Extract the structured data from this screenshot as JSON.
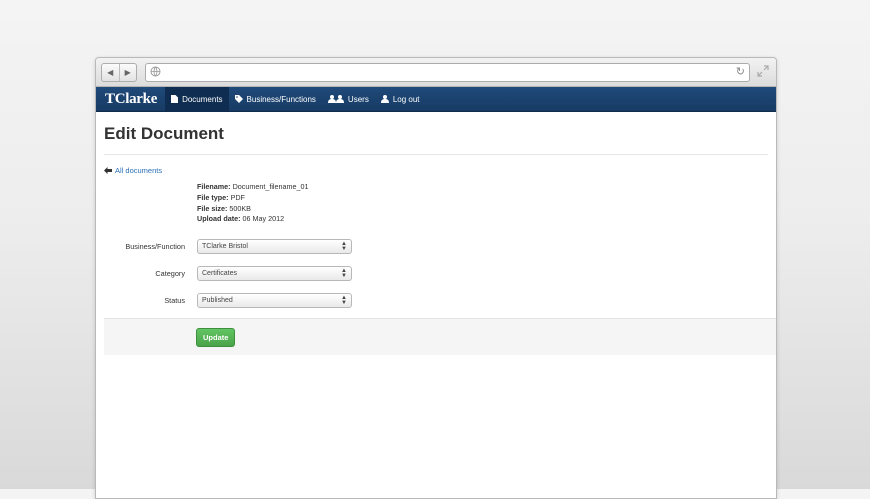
{
  "browser": {
    "url": ""
  },
  "nav": {
    "brand": "TClarke",
    "items": [
      {
        "label": "Documents",
        "icon": "file-icon"
      },
      {
        "label": "Business/Functions",
        "icon": "tag-icon"
      },
      {
        "label": "Users",
        "icon": "users-icon"
      },
      {
        "label": "Log out",
        "icon": "user-icon"
      }
    ]
  },
  "page": {
    "title": "Edit Document",
    "back_link": "All documents"
  },
  "file_info": {
    "filename_label": "Filename:",
    "filename": "Document_filename_01",
    "filetype_label": "File type:",
    "filetype": "PDF",
    "filesize_label": "File size:",
    "filesize": "500KB",
    "upload_label": "Upload date:",
    "upload_date": "06 May 2012"
  },
  "form": {
    "business_label": "Business/Function",
    "business_value": "TClarke Bristol",
    "category_label": "Category",
    "category_value": "Certificates",
    "status_label": "Status",
    "status_value": "Published"
  },
  "actions": {
    "update_label": "Update"
  },
  "colors": {
    "navbar": "#1f4a7a",
    "link": "#2a6fb8",
    "button": "#5bb75b"
  }
}
